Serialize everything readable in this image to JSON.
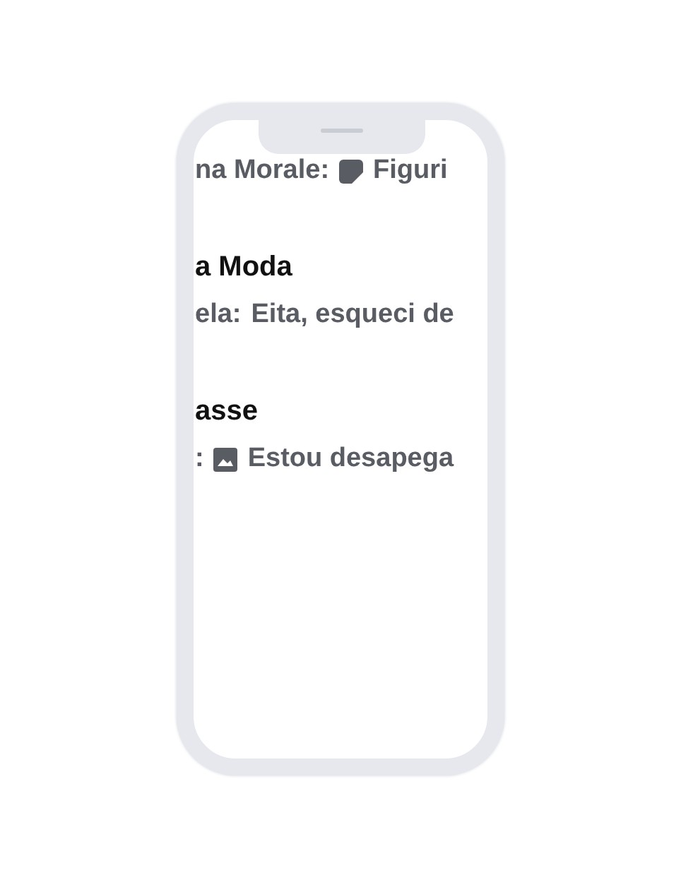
{
  "chats": [
    {
      "kind": "sticker",
      "sender": "na Morale:",
      "preview": "Figuri"
    },
    {
      "kind": "text",
      "name": "a Moda",
      "sender": "ela:",
      "preview": "Eita, esqueci de"
    },
    {
      "kind": "photo",
      "name": "asse",
      "sender": ":",
      "preview": "Estou desapega"
    }
  ]
}
